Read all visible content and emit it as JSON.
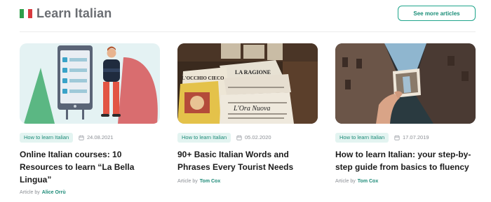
{
  "header": {
    "title": "Learn Italian",
    "see_more_label": "See more articles",
    "flag_colors": [
      "#2e9f4a",
      "#ffffff",
      "#d83a3f"
    ],
    "flag_icon": "italy-flag-icon"
  },
  "articles": [
    {
      "tag": "How to learn Italian",
      "date": "24.08.2021",
      "title": "Online Italian courses: 10 Resources to learn “La Bella Lingua”",
      "byline_prefix": "Article by",
      "author": "Alice Orrù",
      "image": "phone-checklist-illustration"
    },
    {
      "tag": "How to learn Italian",
      "date": "05.02.2020",
      "title": "90+ Basic Italian Words and Phrases Every Tourist Needs",
      "byline_prefix": "Article by",
      "author": "Tom Cox",
      "image": "italian-newspapers-photo",
      "image_text": [
        "L'OCCHIO CIECO",
        "LA RAGIONE",
        "L'Ora Nuova"
      ]
    },
    {
      "tag": "How to learn Italian",
      "date": "17.07.2019",
      "title": "How to learn Italian: your step-by-step guide from basics to fluency",
      "byline_prefix": "Article by",
      "author": "Tom Cox",
      "image": "venice-canal-photo"
    }
  ],
  "colors": {
    "accent": "#1fa58b",
    "tag_bg": "#e3f4f1",
    "muted": "#8b8f95"
  }
}
